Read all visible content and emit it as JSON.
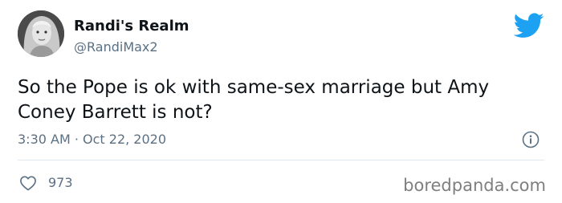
{
  "user": {
    "display_name": "Randi's Realm",
    "handle": "@RandiMax2",
    "avatar_icon": "portrait-avatar"
  },
  "tweet": {
    "text": "So the Pope is ok with same-sex marriage but Amy Coney Barrett is not?",
    "timestamp": "3:30 AM · Oct 22, 2020",
    "likes": "973"
  },
  "icons": {
    "brand": "twitter-bird-icon",
    "info": "info-icon",
    "like": "heart-icon"
  },
  "colors": {
    "twitter_blue": "#1da1f2",
    "secondary_text": "#5b7083"
  },
  "watermark": "boredpanda.com"
}
